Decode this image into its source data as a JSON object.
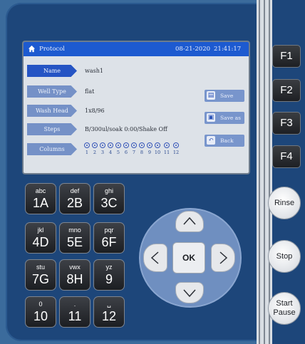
{
  "screen": {
    "title": "Protocol",
    "date": "08-21-2020",
    "time": "21:41:17",
    "fields": [
      {
        "label": "Name",
        "value": "wash1"
      },
      {
        "label": "Well Type",
        "value": "flat"
      },
      {
        "label": "Wash Head",
        "value": "1x8/96"
      },
      {
        "label": "Steps",
        "value": "B/300ul/soak 0:00/Shake Off"
      },
      {
        "label": "Columns",
        "value": ""
      }
    ],
    "columns": [
      "1",
      "2",
      "3",
      "4",
      "5",
      "6",
      "7",
      "8",
      "9",
      "10",
      "11",
      "12"
    ],
    "side_buttons": [
      {
        "label": "Save",
        "icon": "document-icon"
      },
      {
        "label": "Save as",
        "icon": "floppy-icon"
      },
      {
        "label": "Back",
        "icon": "back-arrow-icon"
      }
    ]
  },
  "function_keys": [
    "F1",
    "F2",
    "F3",
    "F4"
  ],
  "round_keys": {
    "rinse": "Rinse",
    "stop": "Stop",
    "start_line1": "Start",
    "start_line2": "Pause"
  },
  "keypad": [
    {
      "small": "abc",
      "big": "1A"
    },
    {
      "small": "def",
      "big": "2B"
    },
    {
      "small": "ghi",
      "big": "3C"
    },
    {
      "small": "jkl",
      "big": "4D"
    },
    {
      "small": "mno",
      "big": "5E"
    },
    {
      "small": "pqr",
      "big": "6F"
    },
    {
      "small": "stu",
      "big": "7G"
    },
    {
      "small": "vwx",
      "big": "8H"
    },
    {
      "small": "yz",
      "big": "9"
    },
    {
      "small": "0",
      "big": "10"
    },
    {
      "small": ".",
      "big": "11"
    },
    {
      "small": "␣",
      "big": "12"
    }
  ],
  "dpad": {
    "ok": "OK"
  },
  "colors": {
    "panel": "#1d467a",
    "lcd_header": "#1d5ad0",
    "lcd_bg": "#dde2e8",
    "field_active": "#2554c4",
    "field_inactive": "#7591c7"
  }
}
